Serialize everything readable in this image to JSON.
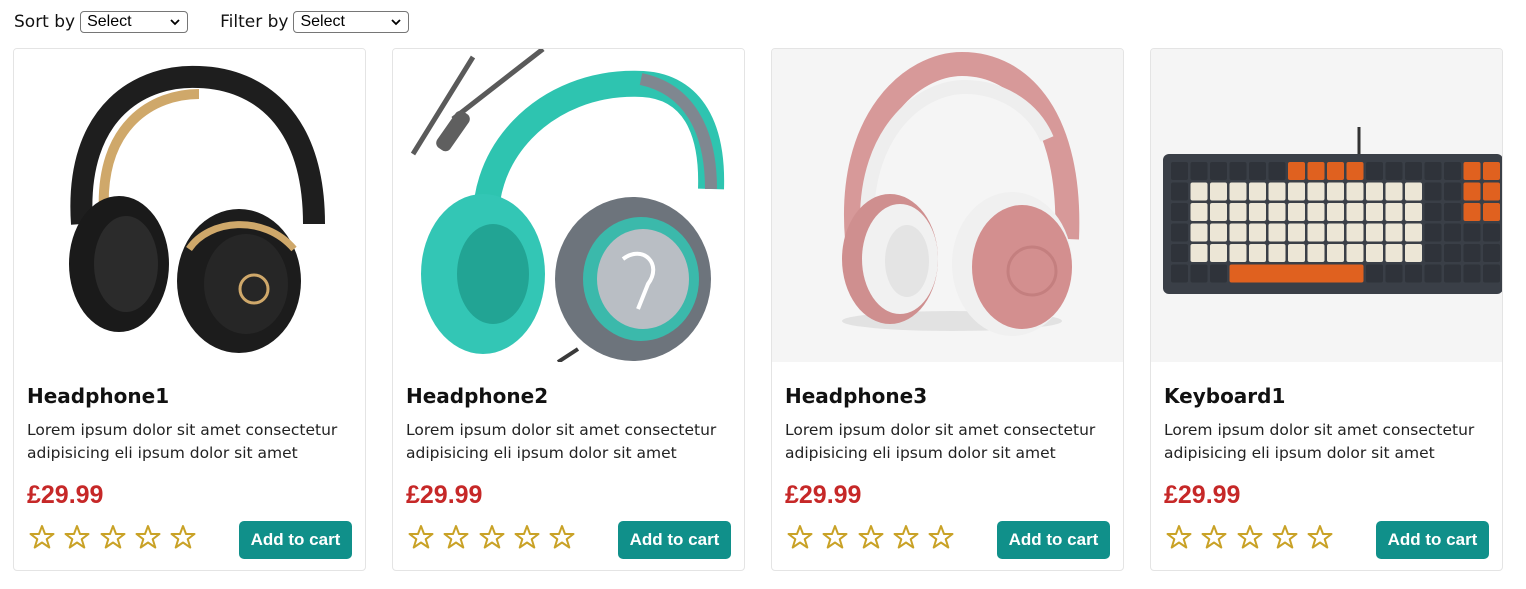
{
  "controls": {
    "sort_label": "Sort by",
    "sort_value": "Select",
    "filter_label": "Filter by",
    "filter_value": "Select"
  },
  "products": [
    {
      "name": "Headphone1",
      "description": "Lorem ipsum dolor sit amet consectetur adipisicing eli ipsum dolor sit amet",
      "price": "£29.99",
      "rating": 0,
      "rating_max": 5,
      "cart_label": "Add to cart",
      "image": "headphones-black-gold"
    },
    {
      "name": "Headphone2",
      "description": "Lorem ipsum dolor sit amet consectetur adipisicing eli ipsum dolor sit amet",
      "price": "£29.99",
      "rating": 0,
      "rating_max": 5,
      "cart_label": "Add to cart",
      "image": "headphones-teal-wired"
    },
    {
      "name": "Headphone3",
      "description": "Lorem ipsum dolor sit amet consectetur adipisicing eli ipsum dolor sit amet",
      "price": "£29.99",
      "rating": 0,
      "rating_max": 5,
      "cart_label": "Add to cart",
      "image": "headphones-rose-gold"
    },
    {
      "name": "Keyboard1",
      "description": "Lorem ipsum dolor sit amet consectetur adipisicing eli ipsum dolor sit amet",
      "price": "£29.99",
      "rating": 0,
      "rating_max": 5,
      "cart_label": "Add to cart",
      "image": "mechanical-keyboard-orange-cream"
    }
  ],
  "colors": {
    "accent": "#10908a",
    "price": "#c62828",
    "star": "#c9a227",
    "image_bg": "#f5f5f5"
  }
}
